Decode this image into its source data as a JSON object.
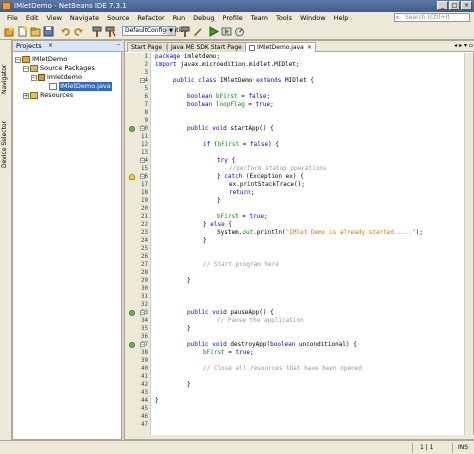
{
  "window": {
    "title": "IMletDemo - NetBeans IDE 7.3.1"
  },
  "menu": [
    "File",
    "Edit",
    "View",
    "Navigate",
    "Source",
    "Refactor",
    "Run",
    "Debug",
    "Profile",
    "Team",
    "Tools",
    "Window",
    "Help"
  ],
  "search": {
    "placeholder": "Search (Ctrl+I)"
  },
  "toolbar": {
    "configuration": "DefaultConfiguration"
  },
  "side_strip": {
    "navigator": "Navigator",
    "device_selector": "Device Selector"
  },
  "projects": {
    "tab": "Projects",
    "close": "×",
    "minimize": "–",
    "tree": {
      "root": "IMletDemo",
      "source_packages": "Source Packages",
      "package": "imletdemo",
      "file": "IMletDemo.java",
      "resources": "Resources"
    }
  },
  "editor": {
    "tabs": [
      "Start Page",
      "Java ME SDK Start Page",
      "IMletDemo.java"
    ],
    "lines": [
      "1",
      "2",
      "3",
      "4",
      "5",
      "6",
      "7",
      "8",
      "9",
      "10",
      "11",
      "12",
      "13",
      "14",
      "15",
      "16",
      "17",
      "18",
      "19",
      "20",
      "21",
      "22",
      "23",
      "24",
      "25",
      "26",
      "27",
      "28",
      "29",
      "30",
      "31",
      "32",
      "33",
      "34",
      "35",
      "36",
      "37",
      "38",
      "39",
      "40",
      "41",
      "42",
      "43",
      "44",
      "45",
      "46",
      "47"
    ],
    "code": {
      "l1a": "package",
      "l1b": " imletdemo;",
      "l2a": "import",
      "l2b": " javax.microedition.midlet.MIDlet;",
      "l4a": "public class",
      "l4b": " IMletDemo ",
      "l4c": "extends",
      "l4d": " MIDlet {",
      "l6a": "boolean ",
      "l6b": "bFirst",
      "l6c": " = ",
      "l6d": "false",
      "l6e": ";",
      "l7a": "boolean ",
      "l7b": "loopFlag",
      "l7c": " = ",
      "l7d": "true",
      "l7e": ";",
      "l10a": "public void",
      "l10b": " startApp() {",
      "l12a": "if",
      "l12b": " (",
      "l12c": "bFirst",
      "l12d": " = ",
      "l12e": "false",
      "l12f": ") {",
      "l14a": "try",
      "l14b": " {",
      "l15": "//perform statup operations",
      "l16a": "} ",
      "l16b": "catch",
      "l16c": " (Exception ex) {",
      "l17": "ex.printStackTrace();",
      "l18a": "return",
      "l18b": ";",
      "l19": "}",
      "l21a": "bFirst",
      "l21b": " = ",
      "l21c": "true",
      "l21d": ";",
      "l22a": "} ",
      "l22b": "else",
      "l22c": " {",
      "l23a": "System.",
      "l23b": "out",
      "l23c": ".println(",
      "l23d": "\"IMlet Demo is already started.....\"",
      "l23e": ");",
      "l24": "}",
      "l27": "// Start program here",
      "l29": "}",
      "l33a": "public void",
      "l33b": " pauseApp() {",
      "l34": "// Pause the application",
      "l35": "}",
      "l37a": "public void",
      "l37b": " destroyApp(",
      "l37c": "boolean",
      "l37d": " unconditional) {",
      "l38a": "bFirst",
      "l38b": " = ",
      "l38c": "true",
      "l38d": ";",
      "l40": "// Close all resources that have been opened",
      "l42": "}",
      "l44": "}"
    }
  },
  "status": {
    "position": "1 | 1",
    "mode": "INS"
  }
}
